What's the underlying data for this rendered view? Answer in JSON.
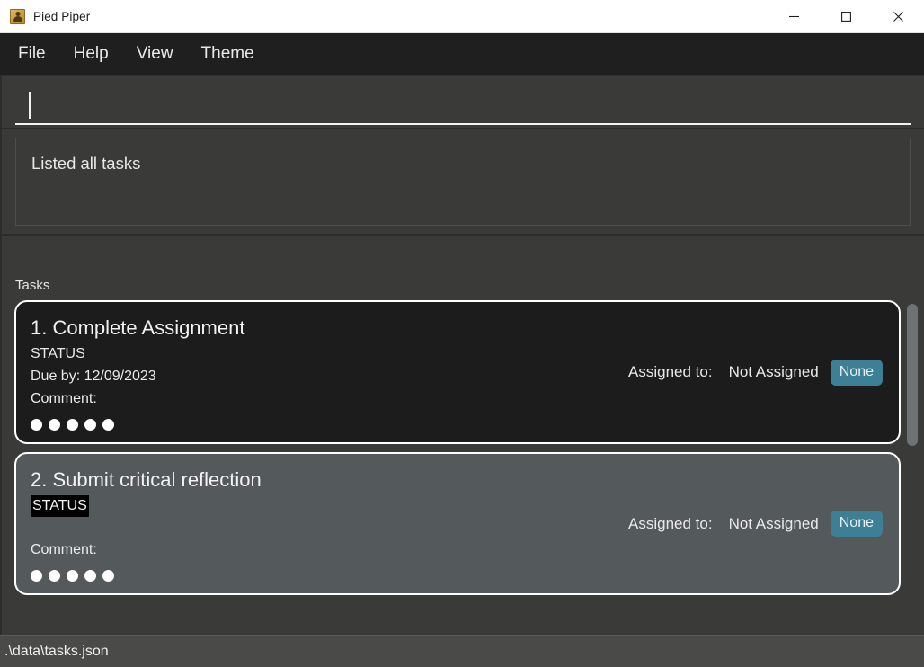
{
  "window": {
    "title": "Pied Piper",
    "icon": "person-icon",
    "controls": {
      "minimize": "minimize-icon",
      "maximize": "maximize-icon",
      "close": "close-icon"
    }
  },
  "menubar": {
    "items": [
      {
        "label": "File"
      },
      {
        "label": "Help"
      },
      {
        "label": "View"
      },
      {
        "label": "Theme"
      }
    ]
  },
  "command_input": {
    "value": "",
    "placeholder": ""
  },
  "output": {
    "text": "Listed all tasks"
  },
  "tasks_section": {
    "label": "Tasks",
    "tasks": [
      {
        "title": "1. Complete Assignment",
        "status": "STATUS",
        "status_highlighted": false,
        "due": "Due by: 12/09/2023",
        "comment_label": "Comment:",
        "dots": 5,
        "assigned_label": "Assigned to:",
        "assignee": "Not Assigned",
        "assign_badge": "None",
        "variant": "variant-dark"
      },
      {
        "title": "2. Submit critical reflection",
        "status": "STATUS",
        "status_highlighted": true,
        "due": "",
        "comment_label": "Comment:",
        "dots": 5,
        "assigned_label": "Assigned to:",
        "assignee": "Not Assigned",
        "assign_badge": "None",
        "variant": "variant-light"
      }
    ]
  },
  "statusbar": {
    "path": ".\\data\\tasks.json"
  },
  "colors": {
    "window_background": "#3a3a38",
    "menubar_background": "#1f1f1f",
    "titlebar_background": "#ffffff",
    "card_dark": "#1c1c1c",
    "card_light": "#545a5c",
    "badge_teal": "#3d7f94",
    "statusbar_background": "#4a4a48",
    "text_primary": "#e9e9e9",
    "card_border": "#ffffff"
  }
}
